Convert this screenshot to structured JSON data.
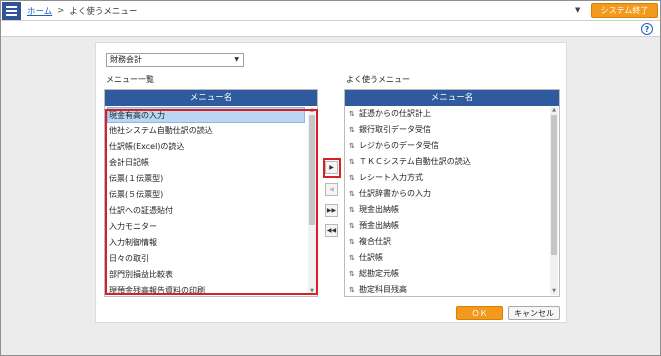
{
  "header": {
    "menu_icon": "hamburger-menu-icon",
    "home_link": "ホーム",
    "separator": ">",
    "current_page": "よく使うメニュー",
    "dropdown_arrow": "▼",
    "exit_button": "システム終了",
    "help_icon": "?"
  },
  "category_select": {
    "value": "財務会計",
    "caret": "▼"
  },
  "menu_list": {
    "section_label": "メニュー一覧",
    "column_header": "メニュー名",
    "items": [
      "現金有高の入力",
      "他社システム自動仕訳の読込",
      "仕訳帳(Excel)の読込",
      "会計日記帳",
      "伝票(１伝票型)",
      "伝票(５伝票型)",
      "仕訳への証憑貼付",
      "入力モニター",
      "入力制御情報",
      "日々の取引",
      "部門別損益比較表",
      "現預金残高報告資料の印刷"
    ]
  },
  "favorites_list": {
    "section_label": "よく使うメニュー",
    "column_header": "メニュー名",
    "reorder_icon": "⇅",
    "items": [
      "証憑からの仕訳計上",
      "銀行取引データ受信",
      "レジからのデータ受信",
      "ＴＫＣシステム自動仕訳の読込",
      "レシート入力方式",
      "仕訳辞書からの入力",
      "現金出納帳",
      "預金出納帳",
      "複合仕訳",
      "仕訳帳",
      "総勘定元帳",
      "勘定科目残高"
    ]
  },
  "move_buttons": {
    "add": "▶",
    "remove": "◀",
    "add_all": "▶▶",
    "remove_all": "◀◀"
  },
  "footer": {
    "ok": "ＯＫ",
    "cancel": "キャンセル"
  }
}
